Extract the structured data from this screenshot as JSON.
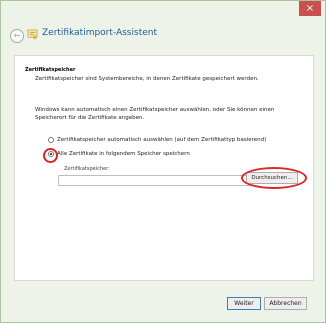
{
  "window": {
    "title": "Zertifikatimport-Assistent",
    "close_glyph": "×"
  },
  "page": {
    "section_title": "Zertifikatspeicher",
    "section_desc": "Zertifikatspeicher sind Systembereiche, in denen Zertifikate gespeichert werden.",
    "explain": "Windows kann automatisch einen Zertifikatspeicher auswählen, oder Sie können einen Speicherort für die Zertifikate angeben.",
    "radio_auto_label": "Zertifikatspeicher automatisch auswählen (auf dem Zertifikattyp basierend)",
    "radio_manual_label": "Alle Zertifikate in folgendem Speicher speichern",
    "store_label": "Zertifikatspeicher:",
    "store_value": "",
    "browse_label": "Durchsuchen...",
    "selected_radio": "manual"
  },
  "footer": {
    "next_label": "Weiter",
    "cancel_label": "Abbrechen"
  },
  "icons": {
    "back": "back-arrow-icon",
    "wizard": "certificate-icon",
    "close": "close-icon"
  },
  "colors": {
    "highlight": "#d8262c",
    "title": "#1e5a96",
    "close_bg": "#c75050"
  }
}
